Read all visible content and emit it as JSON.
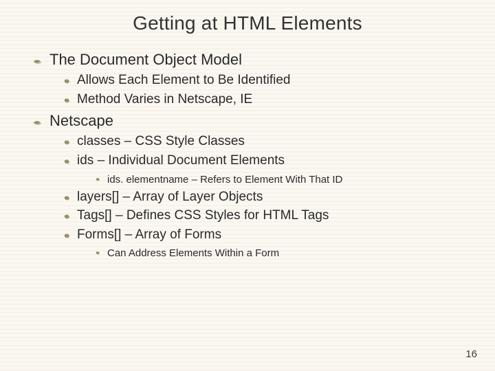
{
  "title": "Getting at HTML Elements",
  "sections": [
    {
      "heading": "The Document Object Model",
      "items": [
        {
          "text": "Allows Each Element to Be Identified"
        },
        {
          "text": "Method Varies in Netscape, IE"
        }
      ]
    },
    {
      "heading": "Netscape",
      "items": [
        {
          "text": "classes – CSS Style Classes"
        },
        {
          "text": "ids – Individual Document Elements",
          "sub": [
            "ids. elementname – Refers to Element With That ID"
          ]
        },
        {
          "text": "layers[] – Array of Layer Objects"
        },
        {
          "text": "Tags[] – Defines CSS Styles for HTML Tags"
        },
        {
          "text": "Forms[] – Array of Forms",
          "sub": [
            "Can Address Elements Within a Form"
          ]
        }
      ]
    }
  ],
  "page_number": "16"
}
